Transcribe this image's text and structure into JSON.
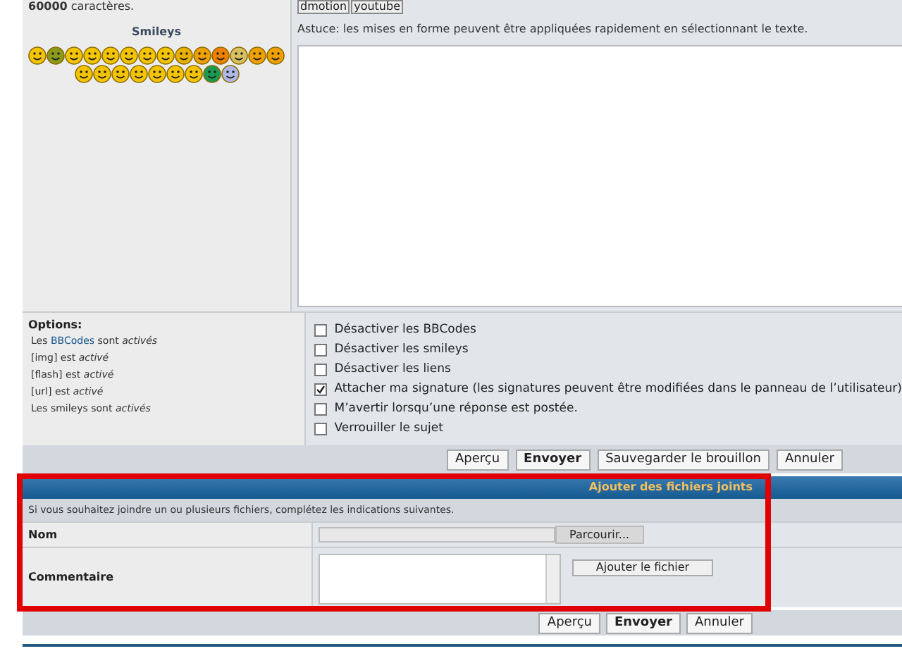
{
  "editor": {
    "char_limit": "60000 caractères.",
    "smileys_title": "Smileys",
    "bbcode_buttons": [
      "dmotion",
      "youtube"
    ],
    "tip": "Astuce: les mises en forme peuvent être appliquées rapidement en sélectionnant le texte."
  },
  "options": {
    "title": "Options:",
    "status": [
      {
        "text": "Les",
        "link": "BBCodes",
        "rest": "sont *activés*"
      },
      {
        "text": "[img] est *activé*"
      },
      {
        "text": "[flash] est *activé*"
      },
      {
        "text": "[url] est *activé*"
      },
      {
        "text": "Les smileys sont *activés*"
      }
    ],
    "checkboxes": [
      {
        "label": "Désactiver les BBCodes",
        "checked": false
      },
      {
        "label": "Désactiver les smileys",
        "checked": false
      },
      {
        "label": "Désactiver les liens",
        "checked": false
      },
      {
        "label": "Attacher ma signature (les signatures peuvent être modifiées dans le panneau de l’utilisateur)",
        "checked": true
      },
      {
        "label": "M’avertir lorsqu’une réponse est postée.",
        "checked": false
      },
      {
        "label": "Verrouiller le sujet",
        "checked": false
      }
    ]
  },
  "buttons": [
    {
      "label": "Aperçu",
      "primary": false
    },
    {
      "label": "Envoyer",
      "primary": true
    },
    {
      "label": "Sauvegarder le brouillon",
      "primary": false
    },
    {
      "label": "Annuler",
      "primary": false
    }
  ],
  "attachments": {
    "title": "Ajouter des fichiers joints",
    "note": "Si vous souhaitez joindre un ou plusieurs fichiers, complétez les indications suivantes.",
    "name_label": "Nom",
    "browse_button": "Parcourir...",
    "comment_label": "Commentaire",
    "add_button": "Ajouter le fichier"
  },
  "bottom_buttons": [
    {
      "label": "Aperçu",
      "primary": false
    },
    {
      "label": "Envoyer",
      "primary": true
    },
    {
      "label": "Annuler",
      "primary": false
    }
  ]
}
